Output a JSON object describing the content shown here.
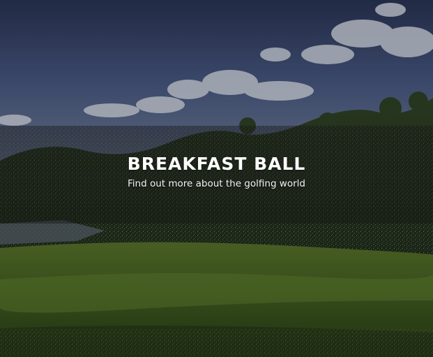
{
  "hero": {
    "title": "BREAKFAST BALL",
    "subtitle": "Find out more about the golfing world",
    "background_image": "golf-course-landscape"
  },
  "colors": {
    "title_text": "#ffffff",
    "subtitle_text": "#f2f2f2",
    "sky_top": "#2b3558",
    "sky_mid": "#55638a",
    "fairway": "#4d6b22",
    "tree_dark": "#1e2c15"
  }
}
